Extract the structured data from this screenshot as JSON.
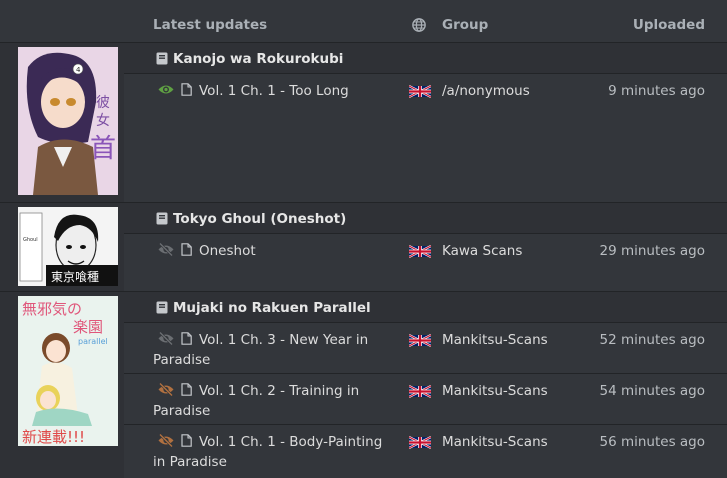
{
  "header": {
    "latest_updates": "Latest updates",
    "group": "Group",
    "uploaded": "Uploaded",
    "globe_icon": "globe-icon"
  },
  "colors": {
    "read_eye": "#5fa043",
    "unread_eye": "#6b6e72",
    "hidden_eye": "#b07040",
    "background": "#33363b"
  },
  "manga": [
    {
      "title": "Kanojo wa Rokurokubi",
      "chapters": [
        {
          "title": "Vol. 1 Ch. 1 - Too Long",
          "group": "/a/nonymous",
          "uploaded": "9 minutes ago",
          "status": "read"
        }
      ]
    },
    {
      "title": "Tokyo Ghoul (Oneshot)",
      "chapters": [
        {
          "title": "Oneshot",
          "group": "Kawa Scans",
          "uploaded": "29 minutes ago",
          "status": "unread"
        }
      ]
    },
    {
      "title": "Mujaki no Rakuen Parallel",
      "chapters": [
        {
          "title": "Vol. 1 Ch. 3 - New Year in Paradise",
          "group": "Mankitsu-Scans",
          "uploaded": "52 minutes ago",
          "status": "unread"
        },
        {
          "title": "Vol. 1 Ch. 2 - Training in Paradise",
          "group": "Mankitsu-Scans",
          "uploaded": "54 minutes ago",
          "status": "hidden"
        },
        {
          "title": "Vol. 1 Ch. 1 - Body-Painting in Paradise",
          "group": "Mankitsu-Scans",
          "uploaded": "56 minutes ago",
          "status": "hidden"
        }
      ]
    }
  ]
}
